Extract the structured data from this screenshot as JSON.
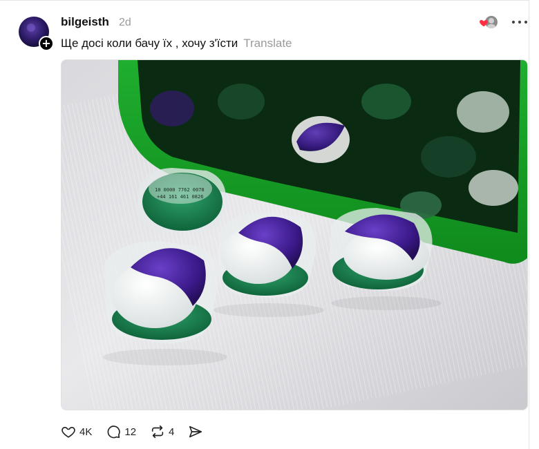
{
  "post": {
    "username": "bilgeisth",
    "time": "2d",
    "text": "Ще досі коли бачу їх , хочу з'їсти",
    "translate_label": "Translate",
    "follow_symbol": "+"
  },
  "actions": {
    "likes": "4K",
    "replies": "12",
    "reposts": "4"
  },
  "icons": {
    "like": "heart-outline-icon",
    "reply": "speech-bubble-icon",
    "repost": "repost-arrows-icon",
    "share": "send-icon",
    "more": "ellipsis-icon"
  },
  "colors": {
    "text": "#111111",
    "muted": "#9a9a9a",
    "like_heart": "#ff3040"
  }
}
